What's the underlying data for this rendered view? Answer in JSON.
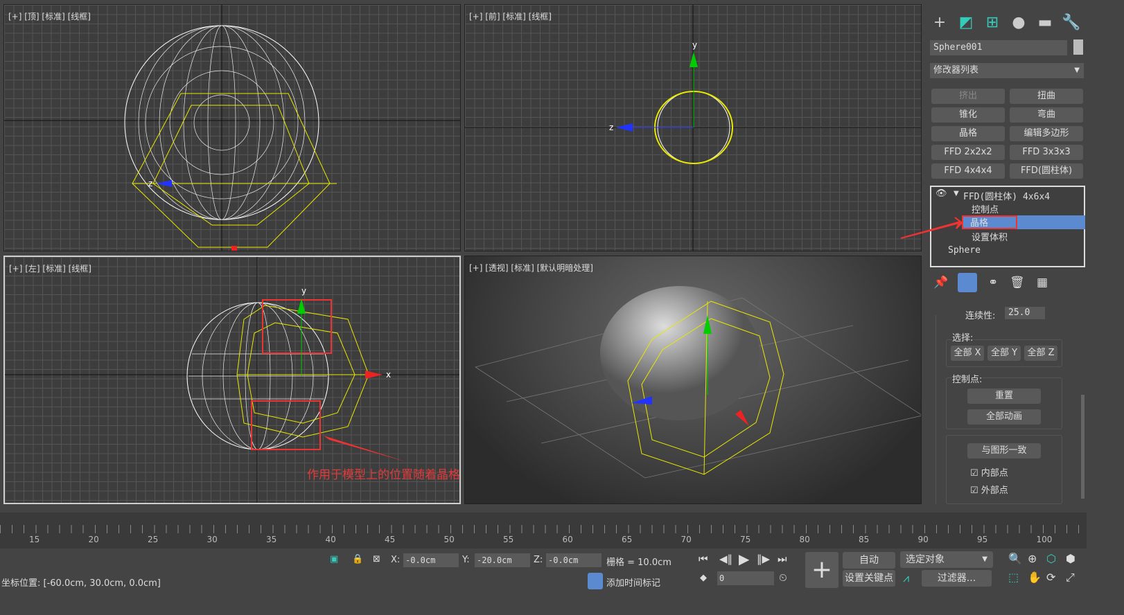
{
  "viewports": [
    {
      "label": "[+] [顶] [标准] [线框]"
    },
    {
      "label": "[+] [前] [标准] [线框]"
    },
    {
      "label": "[+] [左] [标准] [线框]"
    },
    {
      "label": "[+] [透视] [标准] [默认明暗处理]"
    }
  ],
  "axes": {
    "x": "x",
    "y": "y",
    "z": "z"
  },
  "annotation": "作用于模型上的位置随着晶格的移动发生了改变",
  "colors": {
    "accent": "#5b8ad0",
    "annotation": "#e03a3a",
    "lattice": "#e8e800",
    "wire": "#ffffff"
  },
  "panel": {
    "tabs": [
      "create-icon",
      "modify-icon",
      "hierarchy-icon",
      "motion-icon",
      "display-icon",
      "utilities-icon"
    ],
    "object_name": "Sphere001",
    "modifier_list": "修改器列表",
    "modifiers": [
      "挤出",
      "扭曲",
      "锥化",
      "弯曲",
      "晶格",
      "编辑多边形",
      "FFD 2x2x2",
      "FFD 3x3x3",
      "FFD 4x4x4",
      "FFD(圆柱体)"
    ],
    "stack": {
      "top": "FFD(圆柱体) 4x6x4",
      "subs": [
        "控制点",
        "晶格",
        "设置体积"
      ],
      "selected": "晶格",
      "base": "Sphere"
    },
    "continuity_label": "连续性:",
    "continuity_value": "25.0",
    "select_label": "选择:",
    "select_buttons": [
      "全部 X",
      "全部 Y",
      "全部 Z"
    ],
    "cp_label": "控制点:",
    "reset": "重置",
    "animate_all": "全部动画",
    "conform": "与图形一致",
    "inside": "内部点",
    "outside": "外部点"
  },
  "timeline": {
    "ticks": [
      15,
      20,
      25,
      30,
      35,
      40,
      45,
      50,
      55,
      60,
      65,
      70,
      75,
      80,
      85,
      90,
      95,
      100
    ]
  },
  "status": {
    "x": "-0.0cm",
    "y": "-20.0cm",
    "z": "-0.0cm",
    "x_label": "X:",
    "y_label": "Y:",
    "z_label": "Z:",
    "grid": "栅格 = 10.0cm",
    "coords": "坐标位置: [-60.0cm, 30.0cm, 0.0cm]",
    "add_time_tag": "添加时间标记",
    "frame": "0",
    "auto": "自动",
    "set_key": "设置关键点",
    "selected": "选定对象",
    "filters": "过滤器..."
  }
}
